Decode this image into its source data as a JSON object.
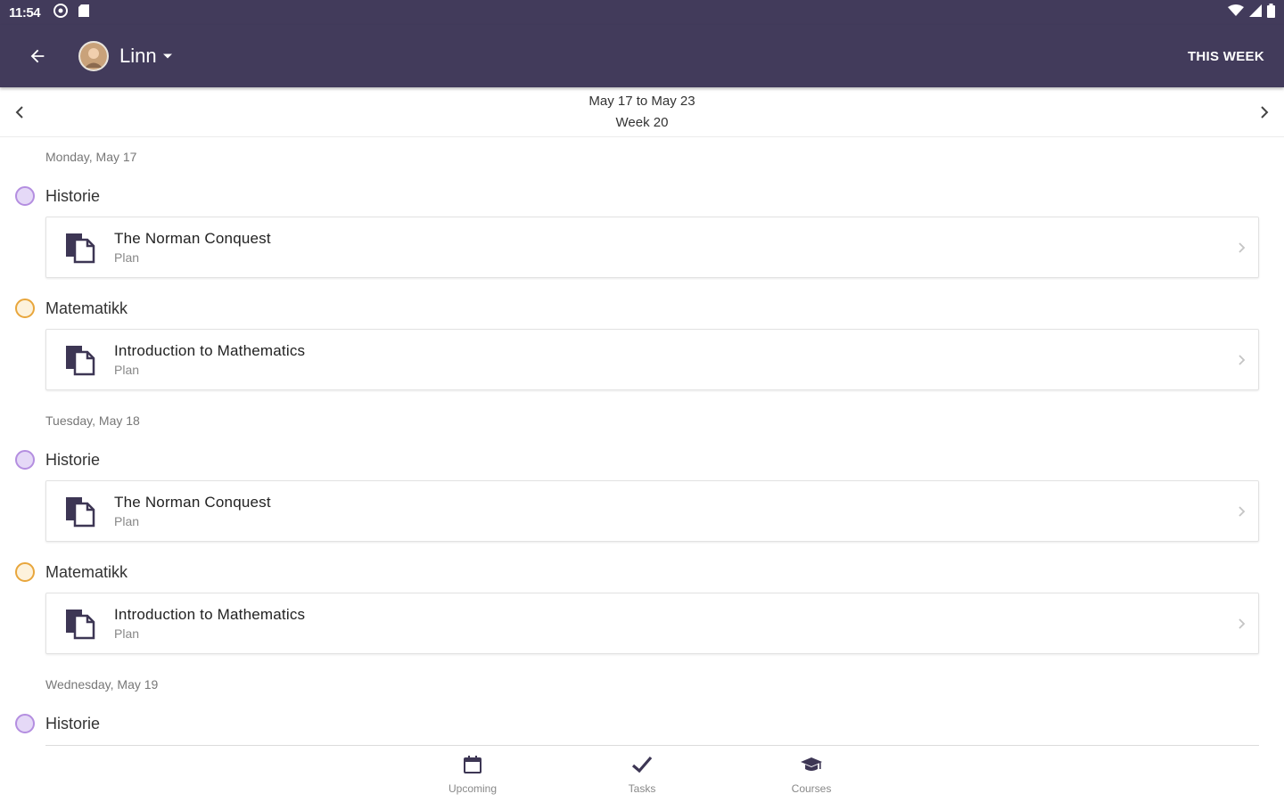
{
  "status_bar": {
    "time": "11:54"
  },
  "app_bar": {
    "profile_name": "Linn",
    "this_week_label": "THIS WEEK"
  },
  "week_nav": {
    "range": "May 17 to May 23",
    "week": "Week 20"
  },
  "colors": {
    "primary": "#423b5b",
    "historie_dot_border": "#b48ee0",
    "historie_dot_fill": "#e5d9f7",
    "matematikk_dot_border": "#e8a63c",
    "matematikk_dot_fill": "#fdf2dc"
  },
  "schedule": {
    "days": [
      {
        "header": "Monday, May 17",
        "courses": [
          {
            "name": "Historie",
            "title": "The Norman Conquest",
            "type": "Plan"
          },
          {
            "name": "Matematikk",
            "title": "Introduction to Mathematics",
            "type": "Plan"
          }
        ]
      },
      {
        "header": "Tuesday, May 18",
        "courses": [
          {
            "name": "Historie",
            "title": "The Norman Conquest",
            "type": "Plan"
          },
          {
            "name": "Matematikk",
            "title": "Introduction to Mathematics",
            "type": "Plan"
          }
        ]
      },
      {
        "header": "Wednesday, May 19",
        "courses": [
          {
            "name": "Historie"
          }
        ]
      }
    ]
  },
  "bottom_nav": {
    "items": [
      {
        "label": "Upcoming",
        "icon": "calendar-icon"
      },
      {
        "label": "Tasks",
        "icon": "checkmark-icon"
      },
      {
        "label": "Courses",
        "icon": "graduation-cap-icon"
      }
    ]
  }
}
